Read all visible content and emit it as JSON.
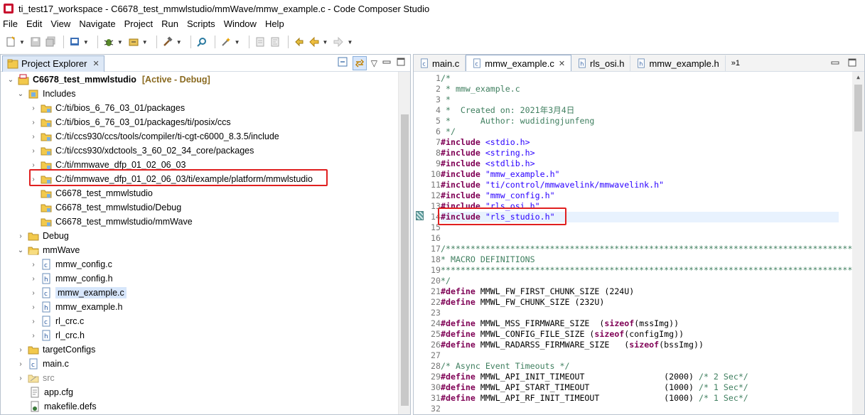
{
  "window": {
    "title": "ti_test17_workspace - C6678_test_mmwlstudio/mmWave/mmw_example.c - Code Composer Studio"
  },
  "menu": [
    "File",
    "Edit",
    "View",
    "Navigate",
    "Project",
    "Run",
    "Scripts",
    "Window",
    "Help"
  ],
  "explorer": {
    "tab_label": "Project Explorer",
    "project": {
      "name": "C6678_test_mmwlstudio",
      "status": "[Active - Debug]"
    },
    "items": [
      {
        "label": "Includes"
      },
      {
        "label": "C:/ti/bios_6_76_03_01/packages"
      },
      {
        "label": "C:/ti/bios_6_76_03_01/packages/ti/posix/ccs"
      },
      {
        "label": "C:/ti/ccs930/ccs/tools/compiler/ti-cgt-c6000_8.3.5/include"
      },
      {
        "label": "C:/ti/ccs930/xdctools_3_60_02_34_core/packages"
      },
      {
        "label": "C:/ti/mmwave_dfp_01_02_06_03"
      },
      {
        "label": "C:/ti/mmwave_dfp_01_02_06_03/ti/example/platform/mmwlstudio"
      },
      {
        "label": "C6678_test_mmwlstudio"
      },
      {
        "label": "C6678_test_mmwlstudio/Debug"
      },
      {
        "label": "C6678_test_mmwlstudio/mmWave"
      },
      {
        "label": "Debug"
      },
      {
        "label": "mmWave"
      },
      {
        "label": "mmw_config.c"
      },
      {
        "label": "mmw_config.h"
      },
      {
        "label": "mmw_example.c"
      },
      {
        "label": "mmw_example.h"
      },
      {
        "label": "rl_crc.c"
      },
      {
        "label": "rl_crc.h"
      },
      {
        "label": "targetConfigs"
      },
      {
        "label": "main.c"
      },
      {
        "label": "src"
      },
      {
        "label": "app.cfg"
      },
      {
        "label": "makefile.defs"
      }
    ]
  },
  "editor": {
    "tabs": [
      {
        "label": "main.c"
      },
      {
        "label": "mmw_example.c"
      },
      {
        "label": "rls_osi.h"
      },
      {
        "label": "mmw_example.h"
      }
    ],
    "overflow": "»1",
    "lines": [
      {
        "n": "1",
        "text": "/*"
      },
      {
        "n": "2",
        "text": " * mmw_example.c"
      },
      {
        "n": "3",
        "text": " *"
      },
      {
        "n": "4",
        "text": " *  Created on: 2021年3月4日"
      },
      {
        "n": "5",
        "text": " *      Author: wudidingjunfeng"
      },
      {
        "n": "6",
        "text": " */"
      },
      {
        "n": "7",
        "kw": "#include",
        "rest": " <stdio.h>"
      },
      {
        "n": "8",
        "kw": "#include",
        "rest": " <string.h>"
      },
      {
        "n": "9",
        "kw": "#include",
        "rest": " <stdlib.h>"
      },
      {
        "n": "10",
        "kw": "#include",
        "rest": " \"mmw_example.h\""
      },
      {
        "n": "11",
        "kw": "#include",
        "rest": " \"ti/control/mmwavelink/mmwavelink.h\""
      },
      {
        "n": "12",
        "kw": "#include",
        "rest": " \"mmw_config.h\""
      },
      {
        "n": "13",
        "kw": "#include",
        "rest": " \"rls_osi.h\""
      },
      {
        "n": "14",
        "kw": "#include",
        "rest": " \"rls_studio.h\""
      },
      {
        "n": "15",
        "text": ""
      },
      {
        "n": "16",
        "text": ""
      },
      {
        "n": "17",
        "text": "/*****************************************************************************************"
      },
      {
        "n": "18",
        "text": "* MACRO DEFINITIONS"
      },
      {
        "n": "19",
        "text": "*****************************************************************************************"
      },
      {
        "n": "20",
        "text": "*/"
      },
      {
        "n": "21",
        "kw": "#define",
        "rest": " MMWL_FW_FIRST_CHUNK_SIZE (224U)"
      },
      {
        "n": "22",
        "kw": "#define",
        "rest": " MMWL_FW_CHUNK_SIZE (232U)"
      },
      {
        "n": "23",
        "text": ""
      },
      {
        "n": "24",
        "kw": "#define",
        "rest": " MMWL_MSS_FIRMWARE_SIZE  (",
        "kw2": "sizeof",
        "rest2": "(mssImg))"
      },
      {
        "n": "25",
        "kw": "#define",
        "rest": " MMWL_CONFIG_FILE_SIZE (",
        "kw2": "sizeof",
        "rest2": "(configImg))"
      },
      {
        "n": "26",
        "kw": "#define",
        "rest": " MMWL_RADARSS_FIRMWARE_SIZE   (",
        "kw2": "sizeof",
        "rest2": "(bssImg))"
      },
      {
        "n": "27",
        "text": ""
      },
      {
        "n": "28",
        "text": "/* Async Event Timeouts */"
      },
      {
        "n": "29",
        "kw": "#define",
        "rest": " MMWL_API_INIT_TIMEOUT                (2000) ",
        "cmt": "/* 2 Sec*/"
      },
      {
        "n": "30",
        "kw": "#define",
        "rest": " MMWL_API_START_TIMEOUT               (1000) ",
        "cmt": "/* 1 Sec*/"
      },
      {
        "n": "31",
        "kw": "#define",
        "rest": " MMWL_API_RF_INIT_TIMEOUT             (1000) ",
        "cmt": "/* 1 Sec*/"
      },
      {
        "n": "32",
        "text": ""
      }
    ]
  }
}
